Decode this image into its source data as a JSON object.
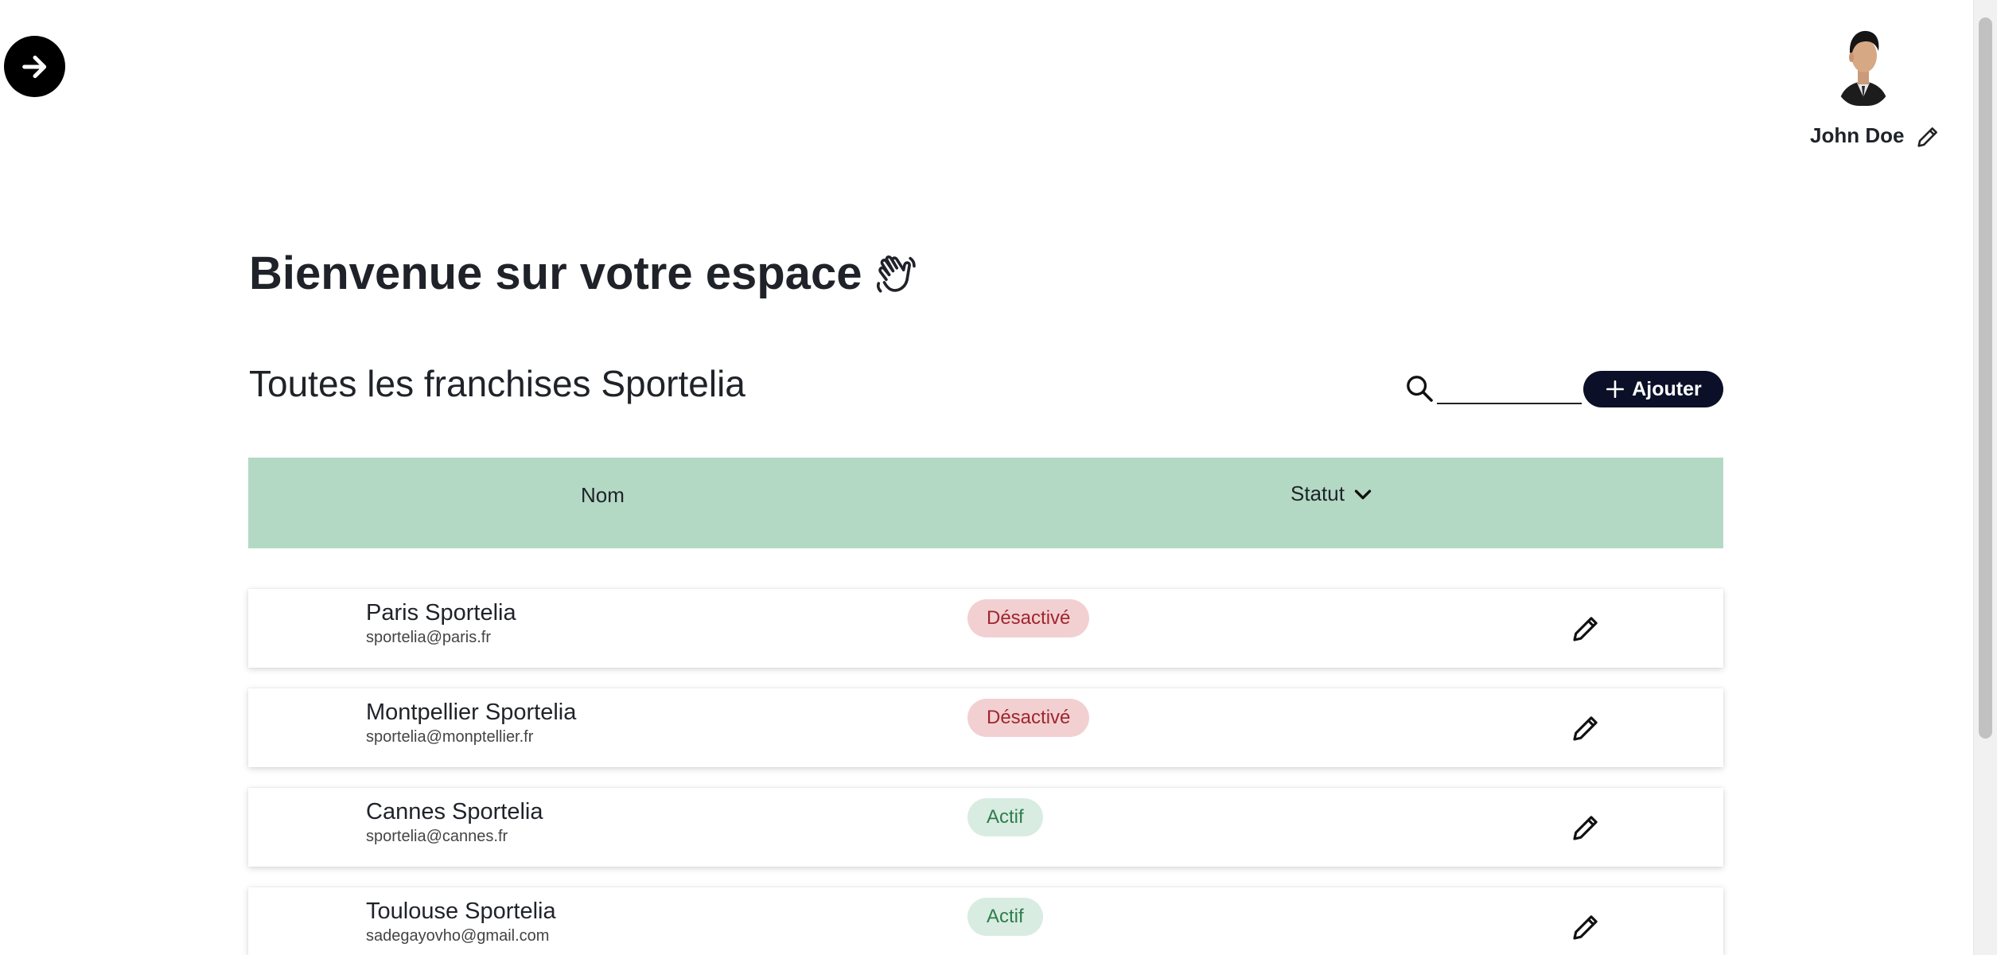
{
  "header": {
    "nav_icon": "arrow-right-circle-icon",
    "user_name": "John Doe",
    "avatar_description_icon": "user-avatar",
    "edit_icon": "pencil-icon"
  },
  "welcome": {
    "title": "Bienvenue sur votre espace",
    "icon": "waving-hand-icon"
  },
  "section": {
    "title": "Toutes les franchises Sportelia"
  },
  "toolbar": {
    "search_icon": "search-icon",
    "search_value": "",
    "add_label": "Ajouter",
    "add_icon": "plus-icon"
  },
  "table": {
    "columns": {
      "name": "Nom",
      "status": "Statut"
    },
    "rows": [
      {
        "name": "Paris Sportelia",
        "email": "sportelia@paris.fr",
        "status": "Désactivé",
        "active": false
      },
      {
        "name": "Montpellier Sportelia",
        "email": "sportelia@monptellier.fr",
        "status": "Désactivé",
        "active": false
      },
      {
        "name": "Cannes Sportelia",
        "email": "sportelia@cannes.fr",
        "status": "Actif",
        "active": true
      },
      {
        "name": "Toulouse Sportelia",
        "email": "sadegayovho@gmail.com",
        "status": "Actif",
        "active": true
      }
    ]
  },
  "colors": {
    "table_header_bg": "#b3d9c5",
    "add_button_bg": "#0b1028",
    "badge_inactive_bg": "#f2d0d2",
    "badge_inactive_text": "#a0262e",
    "badge_active_bg": "#d9ece1",
    "badge_active_text": "#2e7d4c"
  }
}
